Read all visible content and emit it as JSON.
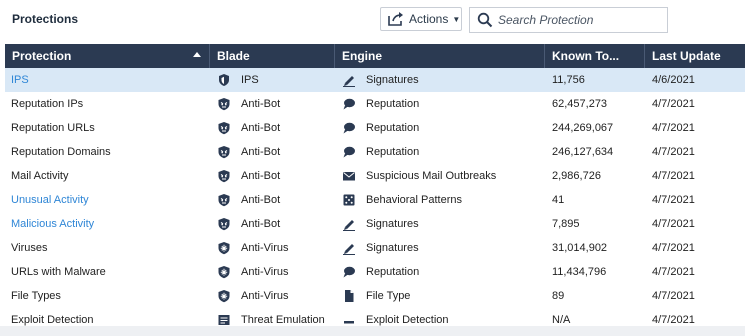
{
  "toolbar": {
    "title": "Protections",
    "actions_label": "Actions",
    "search_placeholder": "Search Protection"
  },
  "colors": {
    "header_bg": "#2b3a52",
    "link": "#2f86d6",
    "selected_row": "#d9e8f6"
  },
  "columns": {
    "protection": "Protection",
    "blade": "Blade",
    "engine": "Engine",
    "known": "Known To...",
    "update": "Last Update"
  },
  "rows": [
    {
      "protection": "IPS",
      "link": true,
      "selected": true,
      "blade": "IPS",
      "blade_icon": "ips-shield-icon",
      "engine": "Signatures",
      "engine_icon": "pen-icon",
      "known": "11,756",
      "update": "4/6/2021"
    },
    {
      "protection": "Reputation IPs",
      "link": false,
      "selected": false,
      "blade": "Anti-Bot",
      "blade_icon": "antibot-icon",
      "engine": "Reputation",
      "engine_icon": "speech-bubble-icon",
      "known": "62,457,273",
      "update": "4/7/2021"
    },
    {
      "protection": "Reputation URLs",
      "link": false,
      "selected": false,
      "blade": "Anti-Bot",
      "blade_icon": "antibot-icon",
      "engine": "Reputation",
      "engine_icon": "speech-bubble-icon",
      "known": "244,269,067",
      "update": "4/7/2021"
    },
    {
      "protection": "Reputation Domains",
      "link": false,
      "selected": false,
      "blade": "Anti-Bot",
      "blade_icon": "antibot-icon",
      "engine": "Reputation",
      "engine_icon": "speech-bubble-icon",
      "known": "246,127,634",
      "update": "4/7/2021"
    },
    {
      "protection": "Mail Activity",
      "link": false,
      "selected": false,
      "blade": "Anti-Bot",
      "blade_icon": "antibot-icon",
      "engine": "Suspicious Mail Outbreaks",
      "engine_icon": "envelope-icon",
      "known": "2,986,726",
      "update": "4/7/2021"
    },
    {
      "protection": "Unusual Activity",
      "link": true,
      "selected": false,
      "blade": "Anti-Bot",
      "blade_icon": "antibot-icon",
      "engine": "Behavioral Patterns",
      "engine_icon": "dice-icon",
      "known": "41",
      "update": "4/7/2021"
    },
    {
      "protection": "Malicious Activity",
      "link": true,
      "selected": false,
      "blade": "Anti-Bot",
      "blade_icon": "antibot-icon",
      "engine": "Signatures",
      "engine_icon": "pen-icon",
      "known": "7,895",
      "update": "4/7/2021"
    },
    {
      "protection": "Viruses",
      "link": false,
      "selected": false,
      "blade": "Anti-Virus",
      "blade_icon": "antivirus-icon",
      "engine": "Signatures",
      "engine_icon": "pen-icon",
      "known": "31,014,902",
      "update": "4/7/2021"
    },
    {
      "protection": "URLs with Malware",
      "link": false,
      "selected": false,
      "blade": "Anti-Virus",
      "blade_icon": "antivirus-icon",
      "engine": "Reputation",
      "engine_icon": "speech-bubble-icon",
      "known": "11,434,796",
      "update": "4/7/2021"
    },
    {
      "protection": "File Types",
      "link": false,
      "selected": false,
      "blade": "Anti-Virus",
      "blade_icon": "antivirus-icon",
      "engine": "File Type",
      "engine_icon": "file-icon",
      "known": "89",
      "update": "4/7/2021"
    },
    {
      "protection": "Exploit Detection",
      "link": false,
      "selected": false,
      "blade": "Threat Emulation",
      "blade_icon": "threat-emulation-icon",
      "engine": "Exploit Detection",
      "engine_icon": "dash-icon",
      "known": "N/A",
      "update": "4/7/2021"
    }
  ]
}
